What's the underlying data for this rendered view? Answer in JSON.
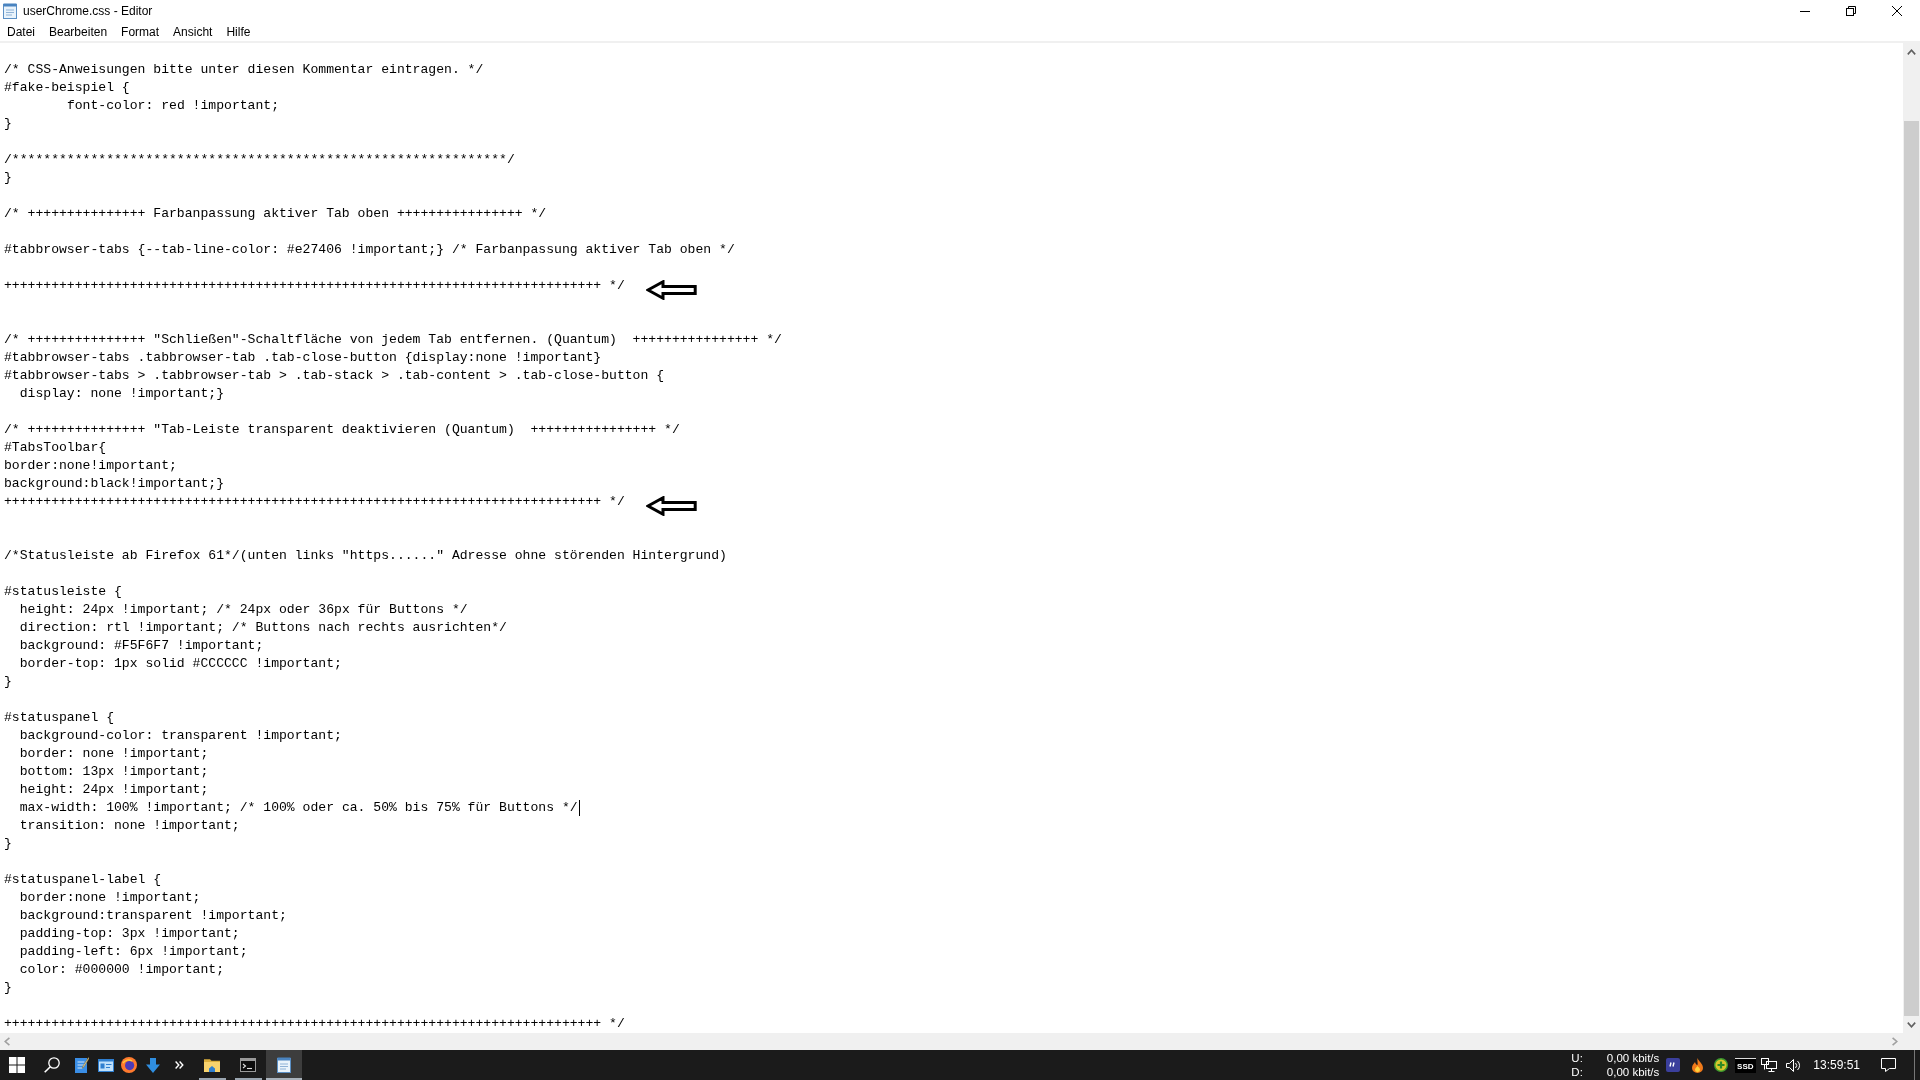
{
  "window": {
    "title": "userChrome.css - Editor"
  },
  "menu": [
    "Datei",
    "Bearbeiten",
    "Format",
    "Ansicht",
    "Hilfe"
  ],
  "editor": {
    "lines": [
      {
        "kind": "blank"
      },
      {
        "kind": "code",
        "text": "/* CSS-Anweisungen bitte unter diesen Kommentar eintragen. */",
        "arrow": false,
        "caret": false
      },
      {
        "kind": "code",
        "text": "#fake-beispiel {",
        "arrow": false,
        "caret": false
      },
      {
        "kind": "code",
        "text": "        font-color: red !important;",
        "arrow": false,
        "caret": false
      },
      {
        "kind": "code",
        "text": "}",
        "arrow": false,
        "caret": false
      },
      {
        "kind": "blank"
      },
      {
        "kind": "code",
        "text": "/***************************************************************/",
        "arrow": false,
        "caret": false
      },
      {
        "kind": "code",
        "text": "}",
        "arrow": false,
        "caret": false
      },
      {
        "kind": "blank"
      },
      {
        "kind": "code",
        "text": "/* +++++++++++++++ Farbanpassung aktiver Tab oben ++++++++++++++++ */",
        "arrow": false,
        "caret": false
      },
      {
        "kind": "blank"
      },
      {
        "kind": "code",
        "text": "#tabbrowser-tabs {--tab-line-color: #e27406 !important;} /* Farbanpassung aktiver Tab oben */",
        "arrow": false,
        "caret": false
      },
      {
        "kind": "blank"
      },
      {
        "kind": "code",
        "text": "++++++++++++++++++++++++++++++++++++++++++++++++++++++++++++++++++++++++++++ */",
        "arrow": true,
        "caret": false
      },
      {
        "kind": "blank"
      },
      {
        "kind": "blank"
      },
      {
        "kind": "code",
        "text": "/* +++++++++++++++ \"Schließen\"-Schaltfläche von jedem Tab entfernen. (Quantum)  ++++++++++++++++ */",
        "arrow": false,
        "caret": false
      },
      {
        "kind": "code",
        "text": "#tabbrowser-tabs .tabbrowser-tab .tab-close-button {display:none !important}",
        "arrow": false,
        "caret": false
      },
      {
        "kind": "code",
        "text": "#tabbrowser-tabs > .tabbrowser-tab > .tab-stack > .tab-content > .tab-close-button {",
        "arrow": false,
        "caret": false
      },
      {
        "kind": "code",
        "text": "  display: none !important;}",
        "arrow": false,
        "caret": false
      },
      {
        "kind": "blank"
      },
      {
        "kind": "code",
        "text": "/* +++++++++++++++ \"Tab-Leiste transparent deaktivieren (Quantum)  ++++++++++++++++ */",
        "arrow": false,
        "caret": false
      },
      {
        "kind": "code",
        "text": "#TabsToolbar{",
        "arrow": false,
        "caret": false
      },
      {
        "kind": "code",
        "text": "border:none!important;",
        "arrow": false,
        "caret": false
      },
      {
        "kind": "code",
        "text": "background:black!important;}",
        "arrow": false,
        "caret": false
      },
      {
        "kind": "code",
        "text": "++++++++++++++++++++++++++++++++++++++++++++++++++++++++++++++++++++++++++++ */",
        "arrow": true,
        "caret": false
      },
      {
        "kind": "blank"
      },
      {
        "kind": "blank"
      },
      {
        "kind": "code",
        "text": "/*Statusleiste ab Firefox 61*/(unten links \"https......\" Adresse ohne störenden Hintergrund)",
        "arrow": false,
        "caret": false
      },
      {
        "kind": "blank"
      },
      {
        "kind": "code",
        "text": "#statusleiste {",
        "arrow": false,
        "caret": false
      },
      {
        "kind": "code",
        "text": "  height: 24px !important; /* 24px oder 36px für Buttons */",
        "arrow": false,
        "caret": false
      },
      {
        "kind": "code",
        "text": "  direction: rtl !important; /* Buttons nach rechts ausrichten*/",
        "arrow": false,
        "caret": false
      },
      {
        "kind": "code",
        "text": "  background: #F5F6F7 !important;",
        "arrow": false,
        "caret": false
      },
      {
        "kind": "code",
        "text": "  border-top: 1px solid #CCCCCC !important;",
        "arrow": false,
        "caret": false
      },
      {
        "kind": "code",
        "text": "}",
        "arrow": false,
        "caret": false
      },
      {
        "kind": "blank"
      },
      {
        "kind": "code",
        "text": "#statuspanel {",
        "arrow": false,
        "caret": false
      },
      {
        "kind": "code",
        "text": "  background-color: transparent !important;",
        "arrow": false,
        "caret": false
      },
      {
        "kind": "code",
        "text": "  border: none !important;",
        "arrow": false,
        "caret": false
      },
      {
        "kind": "code",
        "text": "  bottom: 13px !important;",
        "arrow": false,
        "caret": false
      },
      {
        "kind": "code",
        "text": "  height: 24px !important;",
        "arrow": false,
        "caret": false
      },
      {
        "kind": "code",
        "text": "  max-width: 100% !important; /* 100% oder ca. 50% bis 75% für Buttons */",
        "arrow": false,
        "caret": true
      },
      {
        "kind": "code",
        "text": "  transition: none !important;",
        "arrow": false,
        "caret": false
      },
      {
        "kind": "code",
        "text": "}",
        "arrow": false,
        "caret": false
      },
      {
        "kind": "blank"
      },
      {
        "kind": "code",
        "text": "#statuspanel-label {",
        "arrow": false,
        "caret": false
      },
      {
        "kind": "code",
        "text": "  border:none !important;",
        "arrow": false,
        "caret": false
      },
      {
        "kind": "code",
        "text": "  background:transparent !important;",
        "arrow": false,
        "caret": false
      },
      {
        "kind": "code",
        "text": "  padding-top: 3px !important;",
        "arrow": false,
        "caret": false
      },
      {
        "kind": "code",
        "text": "  padding-left: 6px !important;",
        "arrow": false,
        "caret": false
      },
      {
        "kind": "code",
        "text": "  color: #000000 !important;",
        "arrow": false,
        "caret": false
      },
      {
        "kind": "code",
        "text": "}",
        "arrow": false,
        "caret": false
      },
      {
        "kind": "blank"
      },
      {
        "kind": "code",
        "text": "++++++++++++++++++++++++++++++++++++++++++++++++++++++++++++++++++++++++++++ */",
        "arrow": false,
        "caret": false
      }
    ]
  },
  "taskbar": {
    "apps": [
      {
        "selected": false
      },
      {
        "selected": false
      },
      {
        "selected": true
      }
    ],
    "net_meter": [
      {
        "label": "U:",
        "value": "0,00 kbit/s"
      },
      {
        "label": "D:",
        "value": "0,00 kbit/s"
      }
    ],
    "drive_indicator": "SSD",
    "clock": "13:59:51"
  }
}
